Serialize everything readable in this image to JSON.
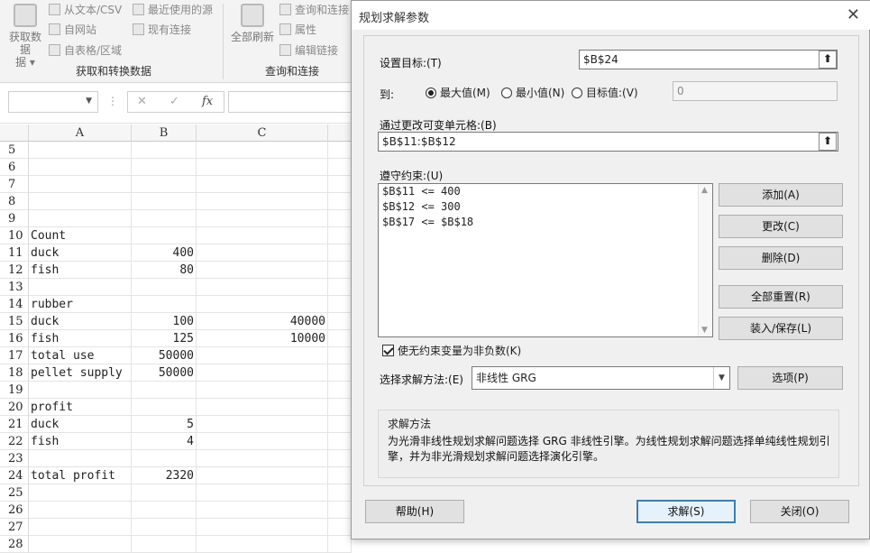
{
  "ribbon": {
    "get_data": "获取数据",
    "get_data_arrow": "据 ▾",
    "from_text_csv": "从文本/CSV",
    "from_web": "自网站",
    "from_table": "自表格/区域",
    "recent_sources": "最近使用的源",
    "existing_connections": "现有连接",
    "group1_label": "获取和转换数据",
    "refresh_all": "全部刷新",
    "queries_connections": "查询和连接",
    "properties": "属性",
    "edit_links": "编辑链接",
    "group2_label": "查询和连接"
  },
  "formula_bar": {
    "namebox": "",
    "cancel": "✕",
    "enter": "✓",
    "fx": "fx",
    "formula": ""
  },
  "sheet": {
    "columns": [
      "A",
      "B",
      "C"
    ],
    "rows": [
      {
        "num": "5",
        "a": "",
        "b": "",
        "c": ""
      },
      {
        "num": "6",
        "a": "",
        "b": "",
        "c": ""
      },
      {
        "num": "7",
        "a": "",
        "b": "",
        "c": ""
      },
      {
        "num": "8",
        "a": "",
        "b": "",
        "c": ""
      },
      {
        "num": "9",
        "a": "",
        "b": "",
        "c": ""
      },
      {
        "num": "10",
        "a": "Count",
        "b": "",
        "c": ""
      },
      {
        "num": "11",
        "a": "duck",
        "b": "400",
        "c": ""
      },
      {
        "num": "12",
        "a": "fish",
        "b": "80",
        "c": ""
      },
      {
        "num": "13",
        "a": "",
        "b": "",
        "c": ""
      },
      {
        "num": "14",
        "a": "rubber",
        "b": "",
        "c": ""
      },
      {
        "num": "15",
        "a": "duck",
        "b": "100",
        "c": "40000"
      },
      {
        "num": "16",
        "a": "fish",
        "b": "125",
        "c": "10000"
      },
      {
        "num": "17",
        "a": "total use",
        "b": "50000",
        "c": ""
      },
      {
        "num": "18",
        "a": "pellet supply",
        "b": "50000",
        "c": ""
      },
      {
        "num": "19",
        "a": "",
        "b": "",
        "c": ""
      },
      {
        "num": "20",
        "a": "profit",
        "b": "",
        "c": ""
      },
      {
        "num": "21",
        "a": "duck",
        "b": "5",
        "c": ""
      },
      {
        "num": "22",
        "a": "fish",
        "b": "4",
        "c": ""
      },
      {
        "num": "23",
        "a": "",
        "b": "",
        "c": ""
      },
      {
        "num": "24",
        "a": "total profit",
        "b": "2320",
        "c": ""
      },
      {
        "num": "25",
        "a": "",
        "b": "",
        "c": ""
      },
      {
        "num": "26",
        "a": "",
        "b": "",
        "c": ""
      },
      {
        "num": "27",
        "a": "",
        "b": "",
        "c": ""
      },
      {
        "num": "28",
        "a": "",
        "b": "",
        "c": ""
      }
    ]
  },
  "dialog": {
    "title": "规划求解参数",
    "close": "✕",
    "set_objective_label": "设置目标:(T)",
    "set_objective_value": "$B$24",
    "to_label": "到:",
    "radio_max": "最大值(M)",
    "radio_min": "最小值(N)",
    "radio_value": "目标值:(V)",
    "target_value": "0",
    "changing_cells_label": "通过更改可变单元格:(B)",
    "changing_cells_value": "$B$11:$B$12",
    "constraints_label": "遵守约束:(U)",
    "constraints": [
      "$B$11 <= 400",
      "$B$12 <= 300",
      "$B$17 <= $B$18"
    ],
    "btn_add": "添加(A)",
    "btn_change": "更改(C)",
    "btn_delete": "删除(D)",
    "btn_reset_all": "全部重置(R)",
    "btn_load_save": "装入/保存(L)",
    "nonneg_label": "使无约束变量为非负数(K)",
    "method_label": "选择求解方法:(E)",
    "method_value": "非线性 GRG",
    "btn_options": "选项(P)",
    "method_box_title": "求解方法",
    "method_box_desc": "为光滑非线性规划求解问题选择 GRG 非线性引擎。为线性规划求解问题选择单纯线性规划引擎，并为非光滑规划求解问题选择演化引擎。",
    "btn_help": "帮助(H)",
    "btn_solve": "求解(S)",
    "btn_close": "关闭(O)"
  }
}
